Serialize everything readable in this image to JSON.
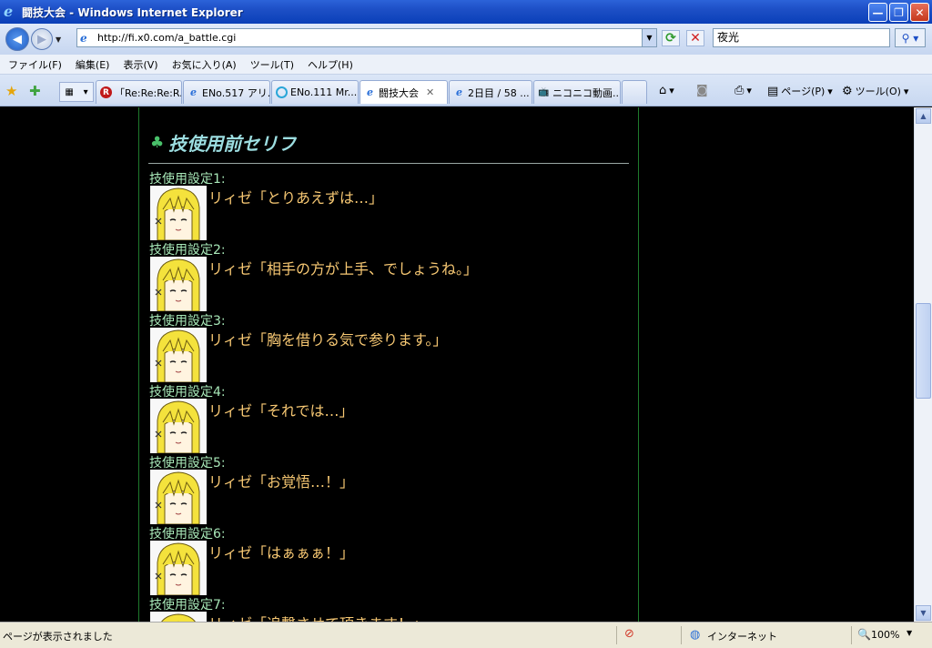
{
  "window": {
    "title": "闘技大会 - Windows Internet Explorer",
    "minimize_glyph": "—",
    "restore_glyph": "❐",
    "close_glyph": "✕"
  },
  "address_bar": {
    "url": "http://fi.x0.com/a_battle.cgi",
    "search_value": "夜光"
  },
  "menu": [
    "ファイル(F)",
    "編集(E)",
    "表示(V)",
    "お気に入り(A)",
    "ツール(T)",
    "ヘルプ(H)"
  ],
  "tabs": [
    {
      "label": "「Re:Re:Re:R...",
      "icon": "rakuten-r-icon"
    },
    {
      "label": "ENo.517 アリ...",
      "icon": "ie-page-icon"
    },
    {
      "label": "ENo.111 Mr....",
      "icon": "circle-site-icon"
    },
    {
      "label": "闘技大会",
      "icon": "ie-page-icon",
      "active": true
    },
    {
      "label": "2日目 / 58 ...",
      "icon": "ie-page-icon"
    },
    {
      "label": "ニコニコ動画...",
      "icon": "tv-icon"
    }
  ],
  "commands": {
    "page_label": "ページ(P)",
    "tools_label": "ツール(O)"
  },
  "content": {
    "section_title": "技使用前セリフ",
    "entries": [
      {
        "label": "技使用設定1:",
        "speech": "リィゼ「とりあえずは…」"
      },
      {
        "label": "技使用設定2:",
        "speech": "リィゼ「相手の方が上手、でしょうね。」"
      },
      {
        "label": "技使用設定3:",
        "speech": "リィゼ「胸を借りる気で参ります。」"
      },
      {
        "label": "技使用設定4:",
        "speech": "リィゼ「それでは…」"
      },
      {
        "label": "技使用設定5:",
        "speech": "リィゼ「お覚悟…！」"
      },
      {
        "label": "技使用設定6:",
        "speech": "リィゼ「はぁぁぁ！」"
      },
      {
        "label": "技使用設定7:",
        "speech": "リィゼ「追撃させて頂きます！」"
      }
    ]
  },
  "statusbar": {
    "status_text": "ページが表示されました",
    "zone": "インターネット",
    "zoom": "100%"
  },
  "colors": {
    "label": "#a8e8b8",
    "speech": "#f7c873",
    "title": "#9cdde0",
    "panel_border": "#1f7a2c"
  }
}
